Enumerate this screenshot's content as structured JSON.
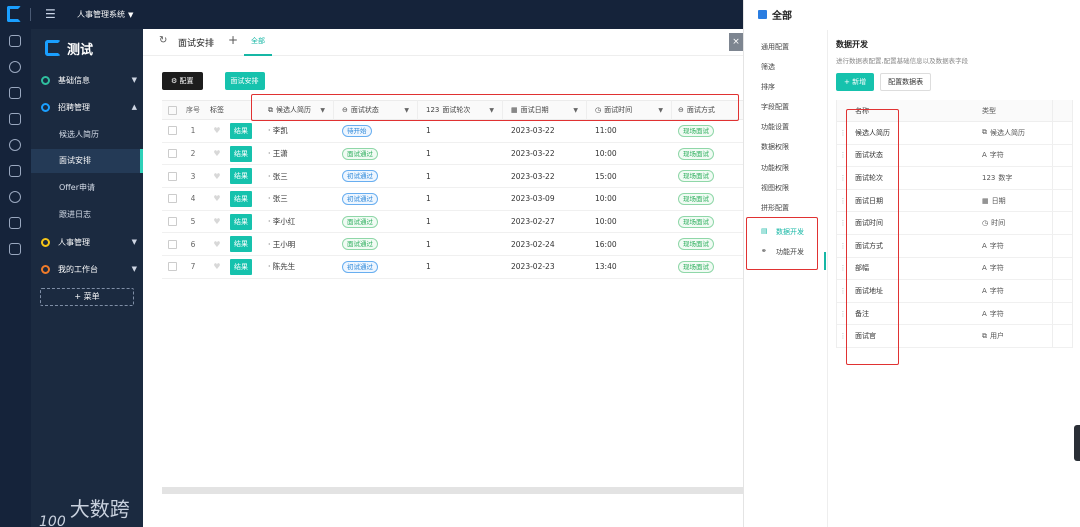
{
  "topbar": {
    "system_name": "人事管理系统"
  },
  "menu": {
    "brand": "测试",
    "groups": [
      {
        "label": "基础信息",
        "color": "#2fbf9f"
      },
      {
        "label": "招聘管理",
        "color": "#1a9fff"
      },
      {
        "label": "人事管理",
        "color": "#f5c518"
      },
      {
        "label": "我的工作台",
        "color": "#f07b29"
      }
    ],
    "sub_items": [
      "候选人简历",
      "面试安排",
      "Offer申请",
      "跟进日志"
    ],
    "add_label": "+ 菜单",
    "watermark_badge": "100",
    "watermark_text": "大数跨境"
  },
  "tabbar": {
    "title": "面试安排",
    "tab_all": "全部"
  },
  "toolbar": {
    "config_label": "配置",
    "view_label": "面试安排"
  },
  "table": {
    "headers": {
      "no": "序号",
      "tag": "标签",
      "name": "候选人简历",
      "status": "面试状态",
      "round": "面试轮次",
      "date": "面试日期",
      "time": "面试时间",
      "way": "面试方式"
    },
    "round_prefix": "123",
    "action_label": "结果",
    "rows": [
      {
        "no": "1",
        "name": "· 李凯",
        "status": "待开始",
        "status_color": "blue",
        "round": "1",
        "date": "2023-03-22",
        "time": "11:00",
        "way": "现场面试"
      },
      {
        "no": "2",
        "name": "· 王潇",
        "status": "面试通过",
        "status_color": "green",
        "round": "1",
        "date": "2023-03-22",
        "time": "10:00",
        "way": "现场面试"
      },
      {
        "no": "3",
        "name": "· 张三",
        "status": "初试通过",
        "status_color": "blue",
        "round": "1",
        "date": "2023-03-22",
        "time": "15:00",
        "way": "现场面试"
      },
      {
        "no": "4",
        "name": "· 张三",
        "status": "初试通过",
        "status_color": "blue",
        "round": "1",
        "date": "2023-03-09",
        "time": "10:00",
        "way": "现场面试"
      },
      {
        "no": "5",
        "name": "· 李小红",
        "status": "面试通过",
        "status_color": "green",
        "round": "1",
        "date": "2023-02-27",
        "time": "10:00",
        "way": "现场面试"
      },
      {
        "no": "6",
        "name": "· 王小明",
        "status": "面试通过",
        "status_color": "green",
        "round": "1",
        "date": "2023-02-24",
        "time": "16:00",
        "way": "现场面试"
      },
      {
        "no": "7",
        "name": "· 陈先生",
        "status": "初试通过",
        "status_color": "blue",
        "round": "1",
        "date": "2023-02-23",
        "time": "13:40",
        "way": "现场面试"
      }
    ]
  },
  "drawer": {
    "title": "全部",
    "nav": [
      "通用配置",
      "筛选",
      "排序",
      "字段配置",
      "功能设置",
      "数据权限",
      "功能权限",
      "视图权限",
      "拼形配置",
      "数据开发",
      "功能开发"
    ],
    "active_nav": "数据开发",
    "section_title": "数据开发",
    "section_desc": "进行数据表配置,配置基础信息以及数据表字段",
    "add_label": "+ 新增",
    "config_table_label": "配置数据表",
    "col_name": "名称",
    "col_type": "类型",
    "fields": [
      {
        "name": "候选人简历",
        "type": "候选人简历",
        "icon": "relation-icon",
        "glyph": "⧉"
      },
      {
        "name": "面试状态",
        "type": "字符",
        "icon": "text-icon",
        "glyph": "A"
      },
      {
        "name": "面试轮次",
        "type": "数字",
        "icon": "number-icon",
        "glyph": "123"
      },
      {
        "name": "面试日期",
        "type": "日期",
        "icon": "calendar-icon",
        "glyph": "▦"
      },
      {
        "name": "面试时间",
        "type": "时间",
        "icon": "clock-icon",
        "glyph": "◷"
      },
      {
        "name": "面试方式",
        "type": "字符",
        "icon": "text-icon",
        "glyph": "A"
      },
      {
        "name": "部幅",
        "type": "字符",
        "icon": "text-icon",
        "glyph": "A"
      },
      {
        "name": "面试地址",
        "type": "字符",
        "icon": "text-icon",
        "glyph": "A"
      },
      {
        "name": "备注",
        "type": "字符",
        "icon": "text-icon",
        "glyph": "A"
      },
      {
        "name": "面试官",
        "type": "用户",
        "icon": "user-icon",
        "glyph": "⧉"
      }
    ]
  },
  "colors": {
    "accent": "#16c2ad",
    "sidebar": "#1b2a40",
    "topbar": "#15233a",
    "highlight": "#e03232"
  }
}
